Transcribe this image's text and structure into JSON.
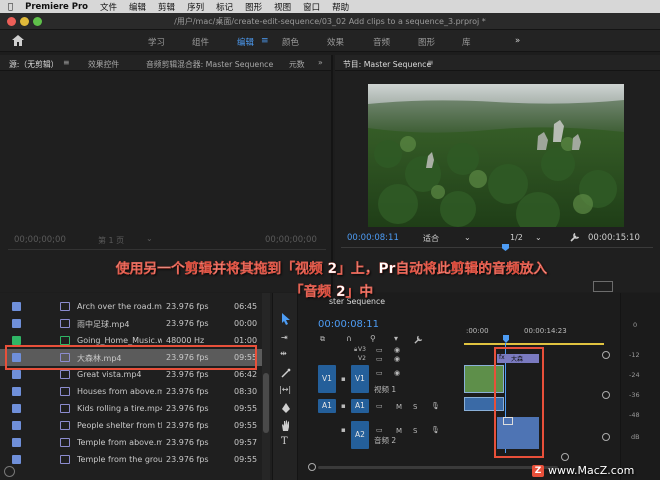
{
  "menubar": {
    "apple": "",
    "app": "Premiere Pro",
    "items": [
      "文件",
      "编辑",
      "剪辑",
      "序列",
      "标记",
      "图形",
      "视图",
      "窗口",
      "帮助"
    ]
  },
  "titlebar": {
    "title": "/用户/mac/桌面/create-edit-sequence/03_02 Add clips to a sequence_3.prproj *"
  },
  "workspaces": {
    "items": [
      "学习",
      "组件",
      "编辑",
      "颜色",
      "效果",
      "音频",
      "图形",
      "库"
    ],
    "active": "编辑",
    "more": "»"
  },
  "source_panel": {
    "tab_source": "源:（无剪辑）",
    "tab_effects": "效果控件",
    "tab_mixer": "音频剪辑混合器: Master Sequence",
    "tab_meta": "元数",
    "more": "»",
    "timecode_left": "00;00;00;00",
    "page": "第 1 页",
    "timecode_right": "00;00;00;00"
  },
  "program_panel": {
    "title": "节目: Master Sequence",
    "timecode": "00:00:08:11",
    "fit": "适合",
    "ratio": "1/2",
    "duration": "00:00:15:10"
  },
  "banner": {
    "line1": "使用另一个剪辑并将其拖到「视频 2」上，Pr自动将此剪辑的音频放入",
    "line2": "「音频 2」中"
  },
  "project_panel": {
    "rows": [
      {
        "name": "Arch over the road.mp4",
        "fps": "23.976 fps",
        "start": "06:45",
        "color": "#6f8fd9"
      },
      {
        "name": "雨中足球.mp4",
        "fps": "23.976 fps",
        "start": "00:00",
        "color": "#6f8fd9"
      },
      {
        "name": "Going_Home_Music.wa",
        "fps": "48000 Hz",
        "start": "01:00",
        "color": "#2fb565"
      },
      {
        "name": "大森林.mp4",
        "fps": "23.976 fps",
        "start": "09:55",
        "color": "#6f8fd9"
      },
      {
        "name": "Great vista.mp4",
        "fps": "23.976 fps",
        "start": "06:42",
        "color": "#6f8fd9"
      },
      {
        "name": "Houses from above.mp4",
        "fps": "23.976 fps",
        "start": "08:30",
        "color": "#6f8fd9"
      },
      {
        "name": "Kids rolling a tire.mp4",
        "fps": "23.976 fps",
        "start": "09:55",
        "color": "#6f8fd9"
      },
      {
        "name": "People shelter from the",
        "fps": "23.976 fps",
        "start": "09:55",
        "color": "#6f8fd9"
      },
      {
        "name": "Temple from above.mp4",
        "fps": "23.976 fps",
        "start": "09:57",
        "color": "#6f8fd9"
      },
      {
        "name": "Temple from the ground",
        "fps": "23.976 fps",
        "start": "09:55",
        "color": "#6f8fd9"
      }
    ],
    "selected_index": 3
  },
  "timeline": {
    "tab": "ster Sequence",
    "timecode": "00:00:08:11",
    "ruler_start": ":00:00",
    "ruler_mid": "00:00:14:23",
    "tracks": {
      "v3": "V3",
      "v2": "V2",
      "v1": "V1",
      "video1": "视频 1",
      "a1": "A1",
      "a2": "A2",
      "audio2": "音频 2",
      "m": "M",
      "s": "S"
    },
    "clip_label": "大森",
    "clip_icon": "fx"
  },
  "meters": {
    "labels": [
      "0",
      "-12",
      "-24",
      "-36",
      "-48",
      "dB"
    ]
  },
  "watermark": {
    "text": "www.MacZ.com",
    "logo": "Z"
  },
  "colors": {
    "accent": "#4d9cf4",
    "highlight": "#e8503a",
    "track": "#245f9a"
  }
}
